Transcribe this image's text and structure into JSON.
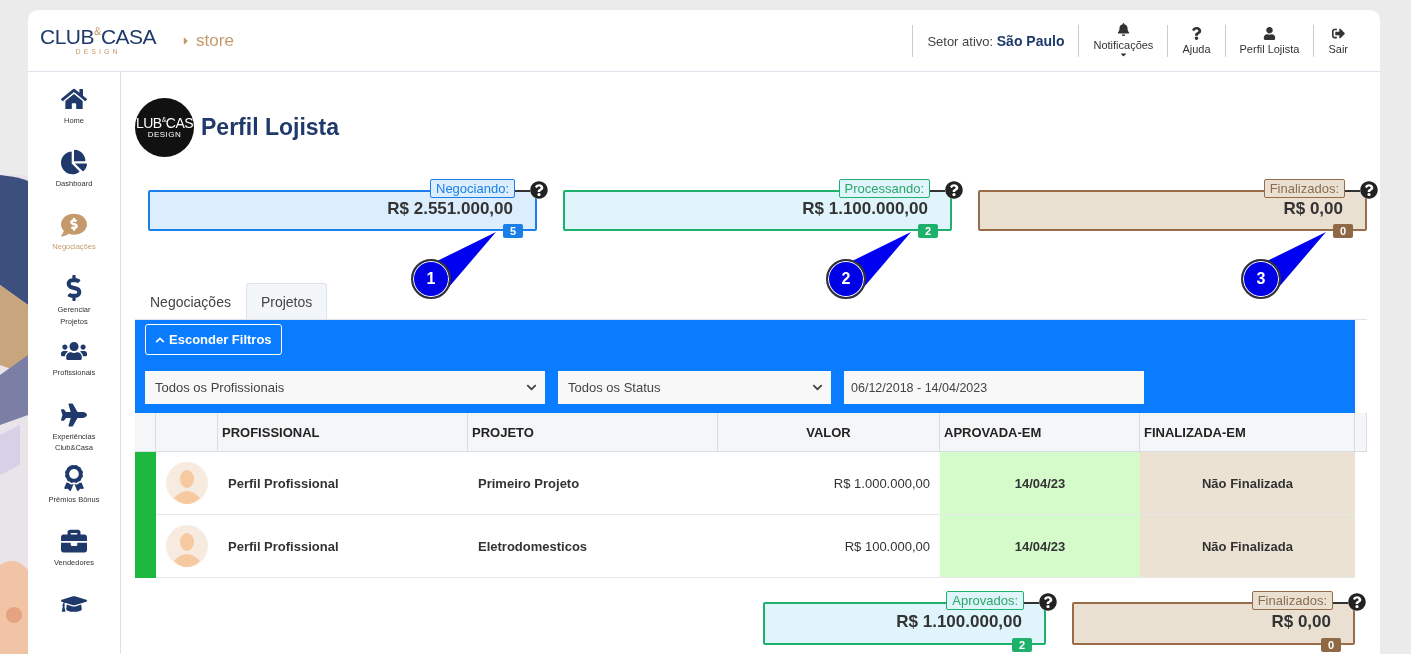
{
  "header": {
    "logo": {
      "left": "CLUB",
      "amp": "&",
      "right": "CASA",
      "sub": "DESIGN"
    },
    "breadcrumb": "store",
    "sector": {
      "label": "Setor ativo:",
      "value": "São Paulo"
    },
    "nav": [
      {
        "label": "Notificações",
        "dropdown": true
      },
      {
        "label": "Ajuda",
        "dropdown": false
      },
      {
        "label": "Perfil Lojista",
        "dropdown": false
      },
      {
        "label": "Sair",
        "dropdown": false
      }
    ]
  },
  "sidebar": {
    "items": [
      {
        "label": "Home",
        "selected": false
      },
      {
        "label": "Dashboard",
        "selected": false
      },
      {
        "label": "Negociações",
        "selected": true
      },
      {
        "label": "Gerenciar Projetos",
        "selected": false
      },
      {
        "label": "Profissionais",
        "selected": false
      },
      {
        "label": "Experiências Club&Casa",
        "selected": false
      },
      {
        "label": "Prêmios Bônus",
        "selected": false
      },
      {
        "label": "Vendedores",
        "selected": false
      },
      {
        "selected": false
      }
    ]
  },
  "profile": {
    "avatar": {
      "left": "LUB",
      "amp": "&",
      "right": "CAS",
      "sub": "DESIGN"
    },
    "title": "Perfil Lojista"
  },
  "stats": [
    {
      "kind": "blue",
      "label": "Negociando:",
      "value": "R$ 2.551.000,00",
      "count": "5",
      "callout": "1"
    },
    {
      "kind": "green",
      "label": "Processando:",
      "value": "R$ 1.100.000,00",
      "count": "2",
      "callout": "2"
    },
    {
      "kind": "brown",
      "label": "Finalizados:",
      "value": "R$ 0,00",
      "count": "0",
      "callout": "3"
    }
  ],
  "tabs": [
    {
      "label": "Negociações",
      "selected": false
    },
    {
      "label": "Projetos",
      "selected": true
    }
  ],
  "filters": {
    "toggle": "Esconder Filtros",
    "selects": [
      "Todos os Profissionais",
      "Todos os Status"
    ],
    "date_range": "06/12/2018 - 14/04/2023"
  },
  "table": {
    "columns": [
      "PROFISSIONAL",
      "PROJETO",
      "VALOR",
      "APROVADA-EM",
      "FINALIZADA-EM"
    ],
    "rows": [
      {
        "color": "#1db83f",
        "professional": "Perfil Profissional",
        "project": "Primeiro Projeto",
        "value": "R$ 1.000.000,00",
        "approved": "14/04/23",
        "finished": "Não Finalizada"
      },
      {
        "color": "#1db83f",
        "professional": "Perfil Profissional",
        "project": "Eletrodomesticos",
        "value": "R$ 100.000,00",
        "approved": "14/04/23",
        "finished": "Não Finalizada"
      }
    ]
  },
  "summary": [
    {
      "kind": "green",
      "label": "Aprovados:",
      "value": "R$ 1.100.000,00",
      "count": "2"
    },
    {
      "kind": "brown",
      "label": "Finalizados:",
      "value": "R$ 0,00",
      "count": "0"
    }
  ]
}
